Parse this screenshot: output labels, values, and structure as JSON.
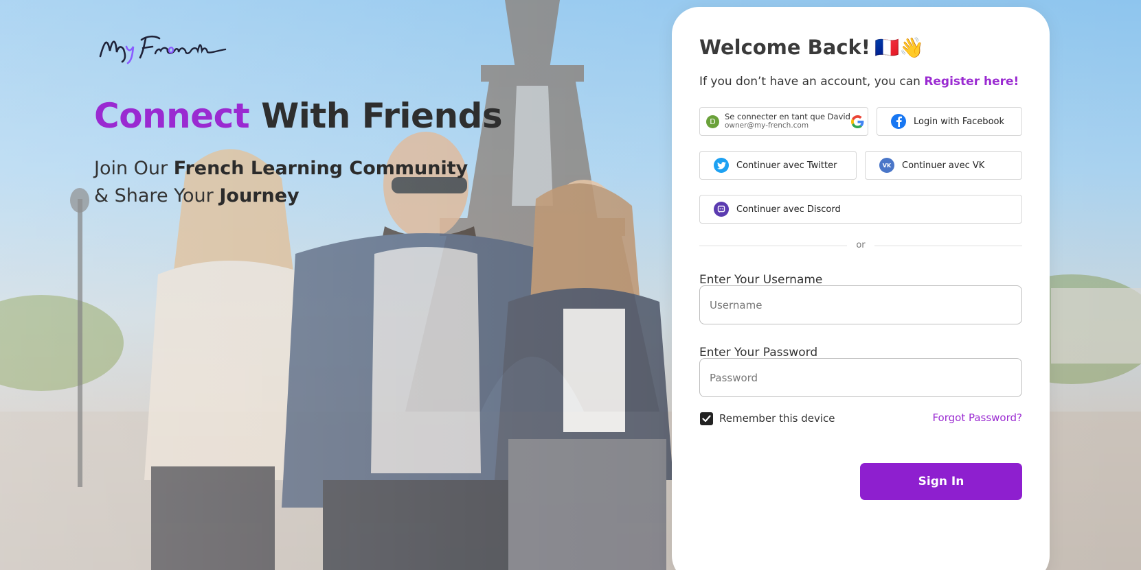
{
  "brand": {
    "logo_text": "MyFrench"
  },
  "hero": {
    "title_accent": "Connect",
    "title_rest": "With Friends",
    "sub_part1": "Join Our ",
    "sub_bold1": "French Learning Community",
    "sub_part2": " & Share Your ",
    "sub_bold2": "Journey"
  },
  "login": {
    "welcome_title": "Welcome Back!",
    "welcome_emoji": "🇫🇷👋",
    "register_prompt": "If you don’t have an account, you can ",
    "register_link": "Register here!",
    "google": {
      "avatar_letter": "D",
      "name_line": "Se connecter en tant que David",
      "email_line": "owner@my-french.com"
    },
    "facebook_label": "Login with Facebook",
    "twitter_label": "Continuer avec Twitter",
    "vk_label": "Continuer avec VK",
    "discord_label": "Continuer avec Discord",
    "divider_text": "or",
    "username_label": "Enter Your Username",
    "username_placeholder": "Username",
    "password_label": "Enter Your Password",
    "password_placeholder": "Password",
    "remember_label": "Remember this device",
    "remember_checked": true,
    "forgot_label": "Forgot Password?",
    "signin_label": "Sign In"
  },
  "colors": {
    "accent": "#9a2ad1",
    "signin": "#8e1fcf",
    "facebook": "#1877f2",
    "twitter": "#1da1f2",
    "vk": "#4a76c8",
    "discord": "#5b3bb0"
  },
  "icons": {
    "google": "google-g-icon",
    "facebook": "facebook-icon",
    "twitter": "twitter-bird-icon",
    "vk": "vk-icon",
    "discord": "discord-icon",
    "check": "checkmark-icon"
  }
}
